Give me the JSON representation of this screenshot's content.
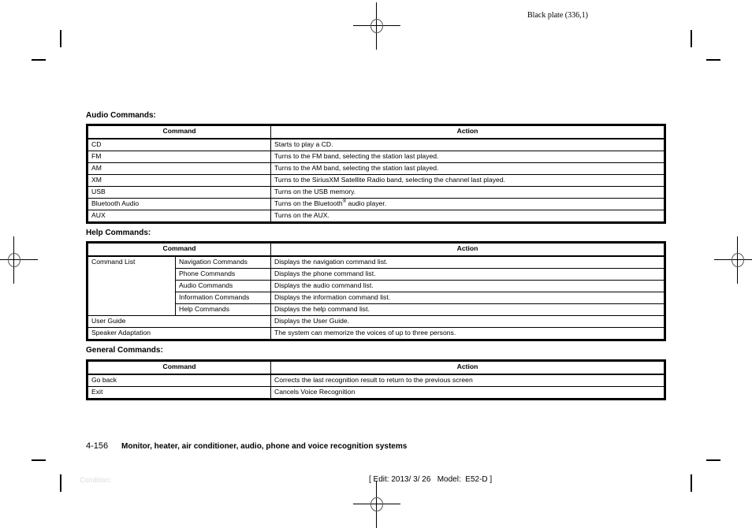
{
  "header": {
    "plate_label": "Black plate (336,1)"
  },
  "sections": [
    {
      "title": "Audio Commands:",
      "columns": [
        "Command",
        "Action"
      ],
      "rows": [
        {
          "command": "CD",
          "action": "Starts to play a CD."
        },
        {
          "command": "FM",
          "action": "Turns to the FM band, selecting the station last played."
        },
        {
          "command": "AM",
          "action": "Turns to the AM band, selecting the station last played."
        },
        {
          "command": "XM",
          "action": "Turns to the SiriusXM Satellite Radio band, selecting the channel last played."
        },
        {
          "command": "USB",
          "action": "Turns on the USB memory."
        },
        {
          "command": "Bluetooth Audio",
          "action_before": "Turns on the Bluetooth",
          "action_sup": "®",
          "action_after": " audio player."
        },
        {
          "command": "AUX",
          "action": "Turns on the AUX."
        }
      ]
    },
    {
      "title": "Help Commands:",
      "columns": [
        "Command",
        "Action"
      ],
      "group_label": "Command List",
      "group_rows": [
        {
          "command": "Navigation Commands",
          "action": "Displays the navigation command list."
        },
        {
          "command": "Phone Commands",
          "action": "Displays the phone command list."
        },
        {
          "command": "Audio Commands",
          "action": "Displays the audio command list."
        },
        {
          "command": "Information Commands",
          "action": "Displays the information command list."
        },
        {
          "command": "Help Commands",
          "action": "Displays the help command list."
        }
      ],
      "rows": [
        {
          "command": "User Guide",
          "action": "Displays the User Guide."
        },
        {
          "command": "Speaker Adaptation",
          "action": "The system can memorize the voices of up to three persons."
        }
      ]
    },
    {
      "title": "General Commands:",
      "columns": [
        "Command",
        "Action"
      ],
      "rows": [
        {
          "command": "Go back",
          "action": "Corrects the last recognition result to return to the previous screen"
        },
        {
          "command": "Exit",
          "action": "Cancels Voice Recognition"
        }
      ]
    }
  ],
  "footer": {
    "page_number": "4-156",
    "chapter_title": "Monitor, heater, air conditioner, audio, phone and voice recognition systems",
    "condition_label": "Condition:",
    "edit_info": "[ Edit: 2013/ 3/ 26   Model:  E52-D ]"
  }
}
